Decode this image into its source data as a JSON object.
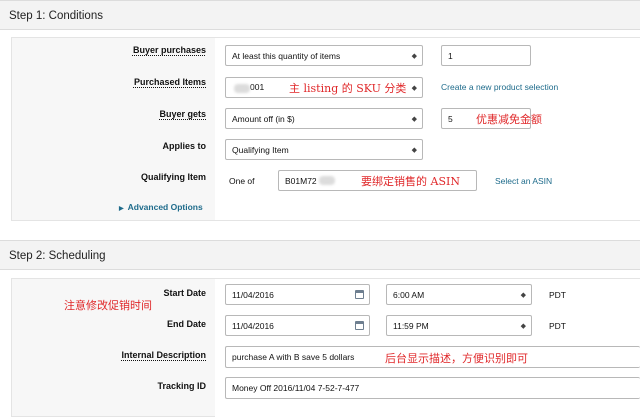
{
  "step1": {
    "title": "Step 1: Conditions",
    "buyer_purchases": {
      "label": "Buyer purchases",
      "select": "At least this quantity of items",
      "value": "1"
    },
    "purchased_items": {
      "label": "Purchased Items",
      "value_prefix": "",
      "value_suffix": "001",
      "note": "主 listing 的 SKU 分类",
      "link": "Create a new product selection"
    },
    "buyer_gets": {
      "label": "Buyer gets",
      "select": "Amount off (in $)",
      "value": "5",
      "note": "优惠减免金额"
    },
    "applies_to": {
      "label": "Applies to",
      "select": "Qualifying Item"
    },
    "qualifying_item": {
      "label": "Qualifying Item",
      "prefix": "One of",
      "value": "B01M72",
      "note": "要绑定销售的 ASIN",
      "link": "Select an ASIN"
    },
    "advanced": "Advanced Options"
  },
  "step2": {
    "title": "Step 2: Scheduling",
    "note_dates": "注意修改促销时间",
    "start_date": {
      "label": "Start Date",
      "date": "11/04/2016",
      "time": "6:00 AM",
      "tz": "PDT"
    },
    "end_date": {
      "label": "End Date",
      "date": "11/04/2016",
      "time": "11:59 PM",
      "tz": "PDT"
    },
    "internal_description": {
      "label": "Internal Description",
      "value": "purchase A with B save 5 dollars",
      "note": "后台显示描述，方便识别即可"
    },
    "tracking_id": {
      "label": "Tracking ID",
      "value": "Money Off 2016/11/04 7-52-7-477"
    }
  },
  "colors": {
    "link": "#1e6b8b",
    "note": "#e0282a",
    "panel": "#f7f7f7"
  },
  "icons": {
    "select": "caret-updown-icon",
    "date": "calendar-icon",
    "disclosure": "triangle-right-icon"
  }
}
